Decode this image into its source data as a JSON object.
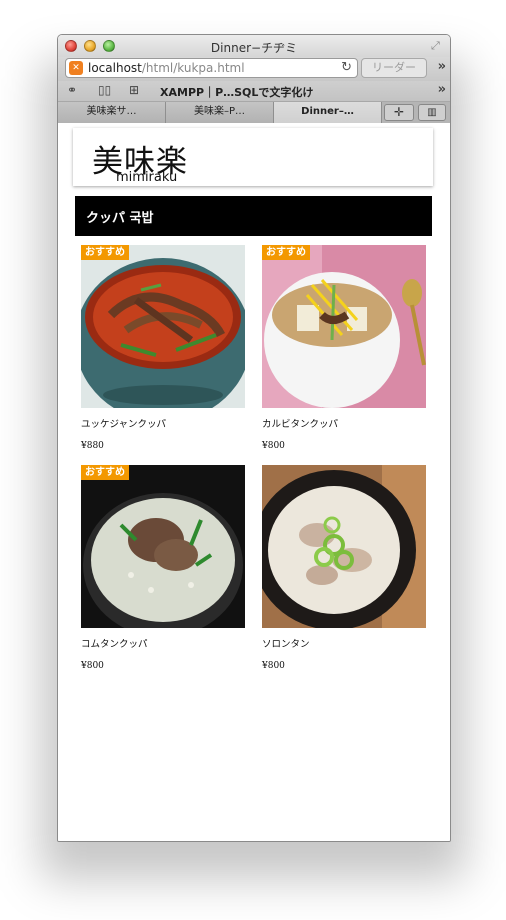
{
  "window": {
    "title": "Dinner−チヂミ"
  },
  "toolbar": {
    "url_host": "localhost",
    "url_path": "/html/kukpa.html",
    "reader_label": "リーダー"
  },
  "bookmarks": {
    "link": "XAMPP｜P…SQLで文字化け"
  },
  "tabs": [
    {
      "label": "美味楽サ…"
    },
    {
      "label": "美味楽–P…"
    },
    {
      "label": "Dinner–…"
    }
  ],
  "site": {
    "logo_jp": "美味楽",
    "logo_en": "mimiraku",
    "category": "クッパ 국밥"
  },
  "colors": {
    "badge": "#f39800",
    "category_bar": "#000000"
  },
  "items": [
    {
      "name": "ユッケジャンクッパ",
      "price": "¥880",
      "badge": "おすすめ",
      "image": "spicy-beef-soup"
    },
    {
      "name": "カルビタンクッパ",
      "price": "¥800",
      "badge": "おすすめ",
      "image": "galbi-soup"
    },
    {
      "name": "コムタンクッパ",
      "price": "¥800",
      "badge": "おすすめ",
      "image": "gomtang-soup"
    },
    {
      "name": "ソロンタン",
      "price": "¥800",
      "badge": "",
      "image": "seolleongtang-soup"
    }
  ]
}
